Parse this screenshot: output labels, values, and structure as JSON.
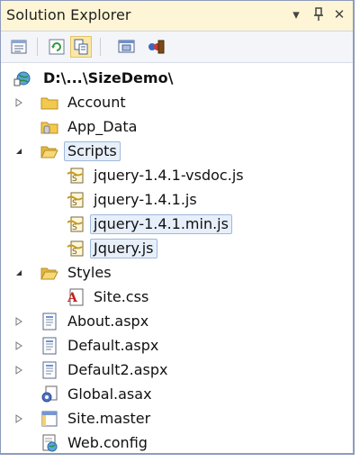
{
  "panel": {
    "title": "Solution Explorer",
    "dropdown_icon": "chevron-down-icon",
    "pin_icon": "pin-icon",
    "close_icon": "close-icon",
    "pin_glyph": "߈",
    "close_glyph": "✕",
    "dropdown_glyph": "▾"
  },
  "toolbar": {
    "buttons": [
      {
        "name": "properties-icon",
        "active": false
      },
      {
        "name": "refresh-icon",
        "active": false
      },
      {
        "name": "show-all-files-icon",
        "active": true
      },
      {
        "name": "view-designer-icon",
        "active": false
      },
      {
        "name": "view-class-diagram-icon",
        "active": false
      }
    ]
  },
  "tree": {
    "root": {
      "label": "D:\\...\\SizeDemo\\"
    },
    "items": [
      {
        "label": "Account",
        "type": "folder",
        "expander": "collapsed"
      },
      {
        "label": "App_Data",
        "type": "folder-special",
        "expander": "none"
      },
      {
        "label": "Scripts",
        "type": "folder-open",
        "expander": "expanded",
        "selected": true
      },
      {
        "label": "jquery-1.4.1-vsdoc.js",
        "type": "js",
        "expander": "none"
      },
      {
        "label": "jquery-1.4.1.js",
        "type": "js",
        "expander": "none"
      },
      {
        "label": "jquery-1.4.1.min.js",
        "type": "js",
        "expander": "none",
        "selected": true
      },
      {
        "label": "Jquery.js",
        "type": "js",
        "expander": "none",
        "selected": true
      },
      {
        "label": "Styles",
        "type": "folder-open",
        "expander": "expanded"
      },
      {
        "label": "Site.css",
        "type": "css",
        "expander": "none"
      },
      {
        "label": "About.aspx",
        "type": "aspx",
        "expander": "collapsed"
      },
      {
        "label": "Default.aspx",
        "type": "aspx",
        "expander": "collapsed"
      },
      {
        "label": "Default2.aspx",
        "type": "aspx",
        "expander": "collapsed"
      },
      {
        "label": "Global.asax",
        "type": "asax",
        "expander": "none"
      },
      {
        "label": "Site.master",
        "type": "master",
        "expander": "collapsed"
      },
      {
        "label": "Web.config",
        "type": "config",
        "expander": "none"
      }
    ]
  },
  "colors": {
    "title_bg": "#fdf5d5",
    "selection_bg": "#e7effa",
    "selection_border": "#9fb9dc",
    "folder": "#f2c94c"
  }
}
